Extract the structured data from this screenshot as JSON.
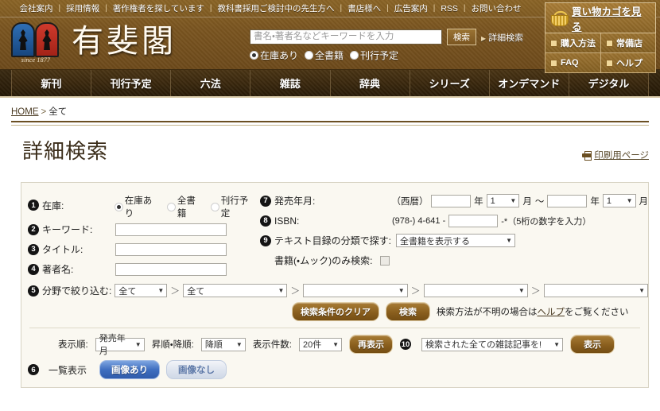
{
  "header": {
    "topnav": [
      {
        "label": "会社案内"
      },
      {
        "label": "採用情報"
      },
      {
        "label": "著作権者を探しています"
      },
      {
        "label": "教科書採用ご検討中の先生方へ"
      },
      {
        "label": "書店様へ"
      },
      {
        "label": "広告案内"
      },
      {
        "label": "RSS"
      },
      {
        "label": "お問い合わせ"
      }
    ],
    "logo": {
      "name": "有斐閣",
      "since": "since 1877"
    },
    "search": {
      "placeholder": "書名・著者名などキーワードを入力",
      "value": "",
      "button": "検索",
      "advanced_link": "詳細検索",
      "radios": [
        {
          "label": "在庫あり",
          "checked": true
        },
        {
          "label": "全書籍",
          "checked": false
        },
        {
          "label": "刊行予定",
          "checked": false
        }
      ]
    },
    "cart": {
      "main": "買い物カゴを見る",
      "links": [
        {
          "label": "購入方法"
        },
        {
          "label": "常備店"
        },
        {
          "label": "FAQ"
        },
        {
          "label": "ヘルプ"
        }
      ]
    }
  },
  "mainnav": [
    {
      "label": "新刊"
    },
    {
      "label": "刊行予定"
    },
    {
      "label": "六法"
    },
    {
      "label": "雑誌"
    },
    {
      "label": "辞典"
    },
    {
      "label": "シリーズ"
    },
    {
      "label": "オンデマンド"
    },
    {
      "label": "デジタル"
    }
  ],
  "breadcrumb": {
    "home": "HOME",
    "sep": ">",
    "current": "全て"
  },
  "page": {
    "title": "詳細検索",
    "print_link": "印刷用ページ"
  },
  "form": {
    "stock": {
      "num": "1",
      "label": "在庫:",
      "options": [
        {
          "label": "在庫あり",
          "checked": true
        },
        {
          "label": "全書籍",
          "checked": false
        },
        {
          "label": "刊行予定",
          "checked": false
        }
      ]
    },
    "keyword": {
      "num": "2",
      "label": "キーワード:",
      "value": ""
    },
    "title": {
      "num": "3",
      "label": "タイトル:",
      "value": ""
    },
    "author": {
      "num": "4",
      "label": "著者名:",
      "value": ""
    },
    "release": {
      "num": "7",
      "label": "発売年月:",
      "era": "（西暦）",
      "from_year": "",
      "year_unit": "年",
      "from_month": "1",
      "month_unit": "月",
      "range_sep": "～",
      "to_year": "",
      "to_month": "1"
    },
    "isbn": {
      "num": "8",
      "label": "ISBN:",
      "prefix": "(978-) 4-641 -",
      "value": "",
      "suffix": "-*（5桁の数字を入力）"
    },
    "catalog": {
      "num": "9",
      "label": "テキスト目録の分類で探す:",
      "value": "全書籍を表示する"
    },
    "book_only": {
      "label": "書籍(・ムック)のみ検索:",
      "checked": false
    },
    "field": {
      "num": "5",
      "label": "分野で絞り込む:",
      "sep": "＞",
      "selects": [
        "全て",
        "全て",
        "",
        "",
        ""
      ]
    },
    "buttons": {
      "clear": "検索条件のクリア",
      "search": "検索",
      "help_prefix": "検索方法が不明の場合は",
      "help_link": "ヘルプ",
      "help_suffix": "をご覧ください"
    },
    "sort": {
      "order_label": "表示順:",
      "order_value": "発売年月",
      "direction_label": "昇順・降順:",
      "direction_value": "降順",
      "count_label": "表示件数:",
      "count_value": "20件",
      "refresh_button": "再表示"
    },
    "magazine": {
      "num": "10",
      "value": "検索された全ての雑誌記事を!",
      "button": "表示"
    },
    "listview": {
      "num": "6",
      "label": "一覧表示",
      "with_image": "画像あり",
      "without_image": "画像なし",
      "active": "with_image"
    }
  },
  "colors": {
    "brand_brown": "#7a5520",
    "nav_dark": "#2a1c08",
    "accent_blue": "#3f6fc0",
    "panel_bg": "#faf8f1"
  }
}
